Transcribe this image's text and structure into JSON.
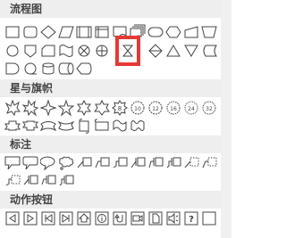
{
  "sections": {
    "flowchart": "流程图",
    "stars_banners": "星与旗帜",
    "callouts": "标注",
    "action_buttons": "动作按钮"
  },
  "highlight": {
    "color": "#e53935",
    "selected_shape": "hourglass-icon"
  },
  "colors": {
    "header_bg": "#eeeeee",
    "header_text": "#444444",
    "shape_stroke": "#444444"
  }
}
